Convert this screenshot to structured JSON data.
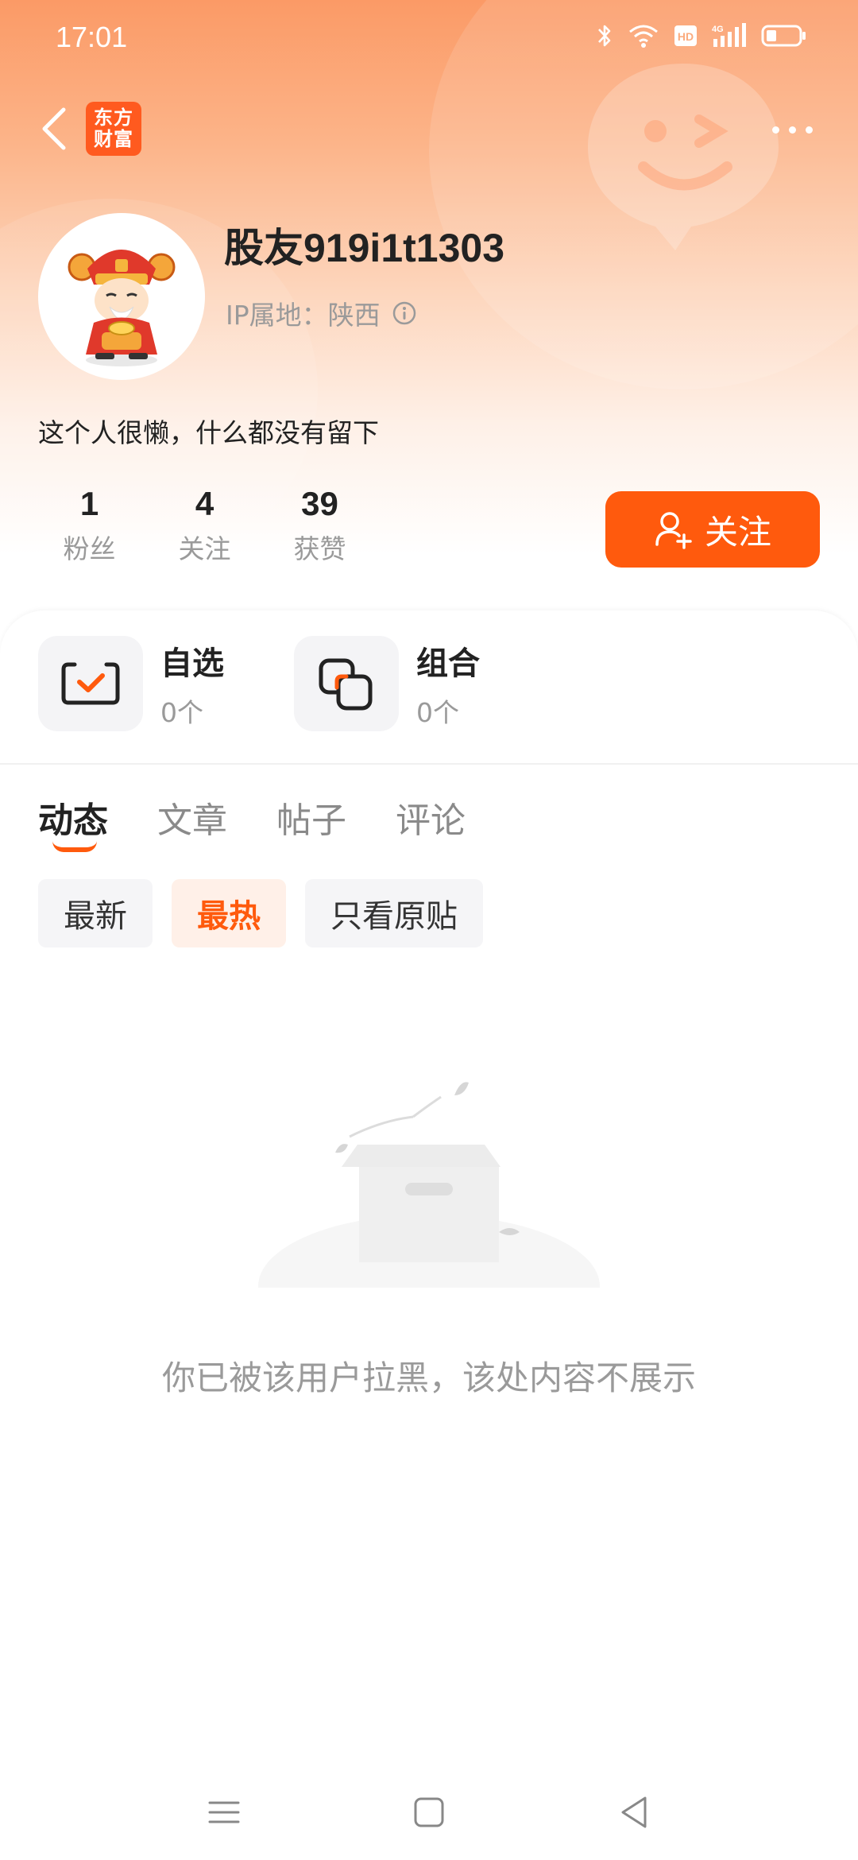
{
  "status_bar": {
    "time": "17:01",
    "network": "4G"
  },
  "header": {
    "logo_text_line1": "东方",
    "logo_text_line2": "财富"
  },
  "profile": {
    "username": "股友919i1t1303",
    "ip_location": "IP属地：陕西",
    "bio": "这个人很懒，什么都没有留下"
  },
  "stats": [
    {
      "value": "1",
      "label": "粉丝"
    },
    {
      "value": "4",
      "label": "关注"
    },
    {
      "value": "39",
      "label": "获赞"
    }
  ],
  "follow_button": {
    "label": "关注"
  },
  "assets": [
    {
      "title": "自选",
      "count": "0个"
    },
    {
      "title": "组合",
      "count": "0个"
    }
  ],
  "tabs": [
    {
      "label": "动态",
      "active": true
    },
    {
      "label": "文章",
      "active": false
    },
    {
      "label": "帖子",
      "active": false
    },
    {
      "label": "评论",
      "active": false
    }
  ],
  "filters": [
    {
      "label": "最新",
      "active": false
    },
    {
      "label": "最热",
      "active": true
    },
    {
      "label": "只看原贴",
      "active": false
    }
  ],
  "empty_state": {
    "message": "你已被该用户拉黑，该处内容不展示"
  },
  "colors": {
    "accent": "#ff5a0d",
    "logo": "#ff5a1f",
    "header_gradient_top": "#fb9a66"
  }
}
